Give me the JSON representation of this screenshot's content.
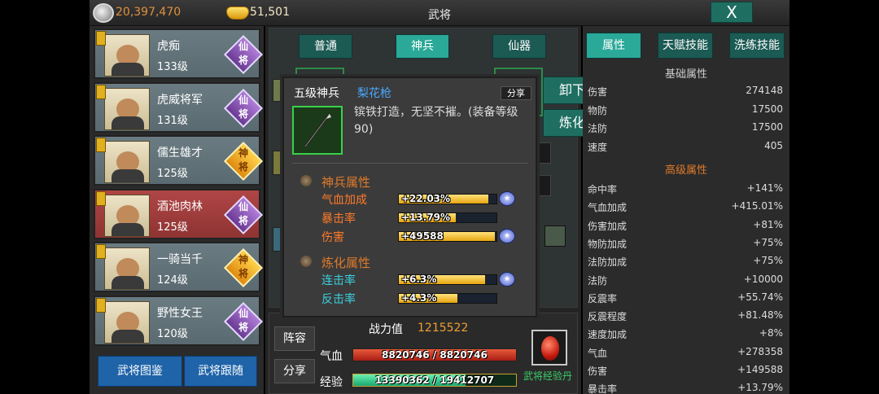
{
  "header": {
    "silver": "20,397,470",
    "gold": "51,501",
    "title": "武将",
    "close_label": "X"
  },
  "generals": [
    {
      "name": "虎痴",
      "level": "133级",
      "badge": "仙将",
      "badge_top": "仙",
      "badge_bottom": "将",
      "type": "xian",
      "selected": false
    },
    {
      "name": "虎威将军",
      "level": "131级",
      "badge": "仙将",
      "badge_top": "仙",
      "badge_bottom": "将",
      "type": "xian",
      "selected": false
    },
    {
      "name": "儒生雄才",
      "level": "125级",
      "badge": "神将",
      "badge_top": "神",
      "badge_bottom": "将",
      "type": "shen",
      "selected": false
    },
    {
      "name": "酒池肉林",
      "level": "125级",
      "badge": "仙将",
      "badge_top": "仙",
      "badge_bottom": "将",
      "type": "xian",
      "selected": true
    },
    {
      "name": "一骑当千",
      "level": "124级",
      "badge": "神将",
      "badge_top": "神",
      "badge_bottom": "将",
      "type": "shen",
      "selected": false
    },
    {
      "name": "野性女王",
      "level": "120级",
      "badge": "仙将",
      "badge_top": "仙",
      "badge_bottom": "将",
      "type": "xian",
      "selected": false
    }
  ],
  "left_buttons": {
    "codex": "武将图鉴",
    "follow": "武将跟随"
  },
  "equip_tabs": [
    "普通",
    "神兵",
    "仙器"
  ],
  "equip_tab_active": 1,
  "bottom": {
    "lineup_label": "阵容",
    "share_label": "分享",
    "power_label": "战力值",
    "power_value": "1215522",
    "hp_label": "气血",
    "hp_text": "8820746 / 8820746",
    "hp_ratio": 1.0,
    "exp_label": "经验",
    "exp_text": "13390362 / 19412707",
    "exp_ratio": 0.69,
    "exp_pill_label": "武将经验丹"
  },
  "popup": {
    "grade": "五级神兵",
    "item_name": "梨花枪",
    "share_label": "分享",
    "description": "镔铁打造，无坚不摧。(装备等级90)",
    "section1_title": "神兵属性",
    "section1_stats": [
      {
        "name": "气血加成",
        "value": "+22.03%",
        "fill": 0.92,
        "upgrade": true
      },
      {
        "name": "暴击率",
        "value": "+13.79%",
        "fill": 0.58,
        "upgrade": false
      },
      {
        "name": "伤害",
        "value": "+49588",
        "fill": 0.98,
        "upgrade": true
      }
    ],
    "section2_title": "炼化属性",
    "section2_stats": [
      {
        "name": "连击率",
        "value": "+6.3%",
        "fill": 0.88,
        "upgrade": true
      },
      {
        "name": "反击率",
        "value": "+4.3%",
        "fill": 0.6,
        "upgrade": false
      }
    ],
    "unequip_label": "卸下",
    "refine_label": "炼化"
  },
  "right_tabs": [
    "属性",
    "天赋技能",
    "洗练技能"
  ],
  "right_tab_active": 0,
  "basic_title": "基础属性",
  "basic_attrs": [
    {
      "name": "伤害",
      "value": "274148"
    },
    {
      "name": "物防",
      "value": "17500"
    },
    {
      "name": "法防",
      "value": "17500"
    },
    {
      "name": "速度",
      "value": "405"
    }
  ],
  "advanced_title": "高级属性",
  "advanced_attrs": [
    {
      "name": "命中率",
      "value": "+141%"
    },
    {
      "name": "气血加成",
      "value": "+415.01%"
    },
    {
      "name": "伤害加成",
      "value": "+81%"
    },
    {
      "name": "物防加成",
      "value": "+75%"
    },
    {
      "name": "法防加成",
      "value": "+75%"
    },
    {
      "name": "法防",
      "value": "+10000"
    },
    {
      "name": "反震率",
      "value": "+55.74%"
    },
    {
      "name": "反震程度",
      "value": "+81.48%"
    },
    {
      "name": "速度加成",
      "value": "+8%"
    },
    {
      "name": "气血",
      "value": "+278358"
    },
    {
      "name": "伤害",
      "value": "+149588"
    },
    {
      "name": "暴击率",
      "value": "+13.79%"
    }
  ],
  "colors": {
    "accent": "#2aa898",
    "section_title": "#e07a2a",
    "stat_orange": "#ff7a2a",
    "stat_cyan": "#3ad0e0",
    "item_name": "#4aa8ff",
    "power_value": "#f0a030"
  }
}
